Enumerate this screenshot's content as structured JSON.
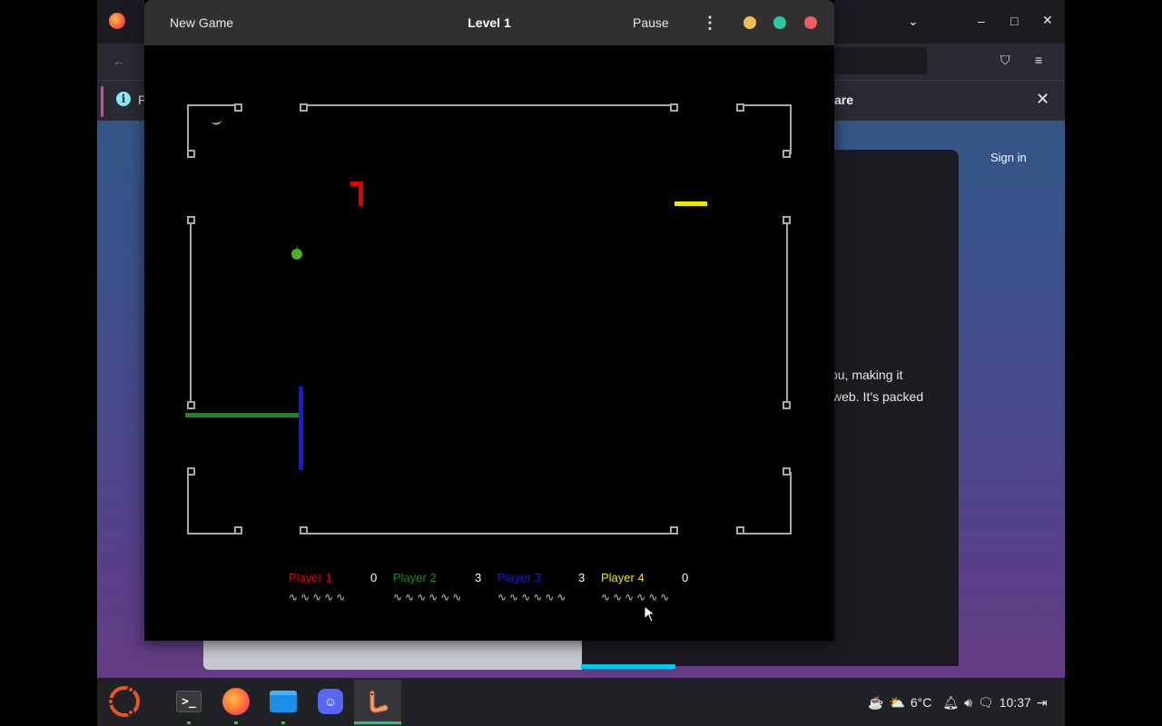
{
  "browser": {
    "notification_text_start": "F",
    "notification_text_end": "are",
    "sign_in": "Sign in",
    "content_line1": "ou, making it",
    "content_line2": "web. It’s packed",
    "icons": [
      "firefox-logo",
      "back-arrow-icon",
      "pocket-icon",
      "hamburger-menu-icon",
      "info-icon",
      "close-icon",
      "chevron-down-icon",
      "minimize-icon",
      "maximize-icon",
      "close-window-icon"
    ]
  },
  "game": {
    "new_game_label": "New Game",
    "title": "Level 1",
    "pause_label": "Pause",
    "menu_glyph": "⋮",
    "players": [
      {
        "name": "Player 1",
        "score": "0",
        "color": "#e00000",
        "lives": 5
      },
      {
        "name": "Player 2",
        "score": "3",
        "color": "#1a8a1a",
        "lives": 6
      },
      {
        "name": "Player 3",
        "score": "3",
        "color": "#1a1ad8",
        "lives": 6
      },
      {
        "name": "Player 4",
        "score": "0",
        "color": "#e8e800",
        "lives": 6
      }
    ],
    "items": [
      "banana",
      "apple"
    ],
    "window_colors": {
      "minimize": "#f4bf4f",
      "maximize": "#29c8a3",
      "close": "#ed5f5f"
    }
  },
  "taskbar": {
    "apps": [
      "terminal",
      "firefox",
      "files",
      "discord",
      "gnome-nibbles"
    ],
    "weather": "6°C",
    "time": "10:37"
  }
}
